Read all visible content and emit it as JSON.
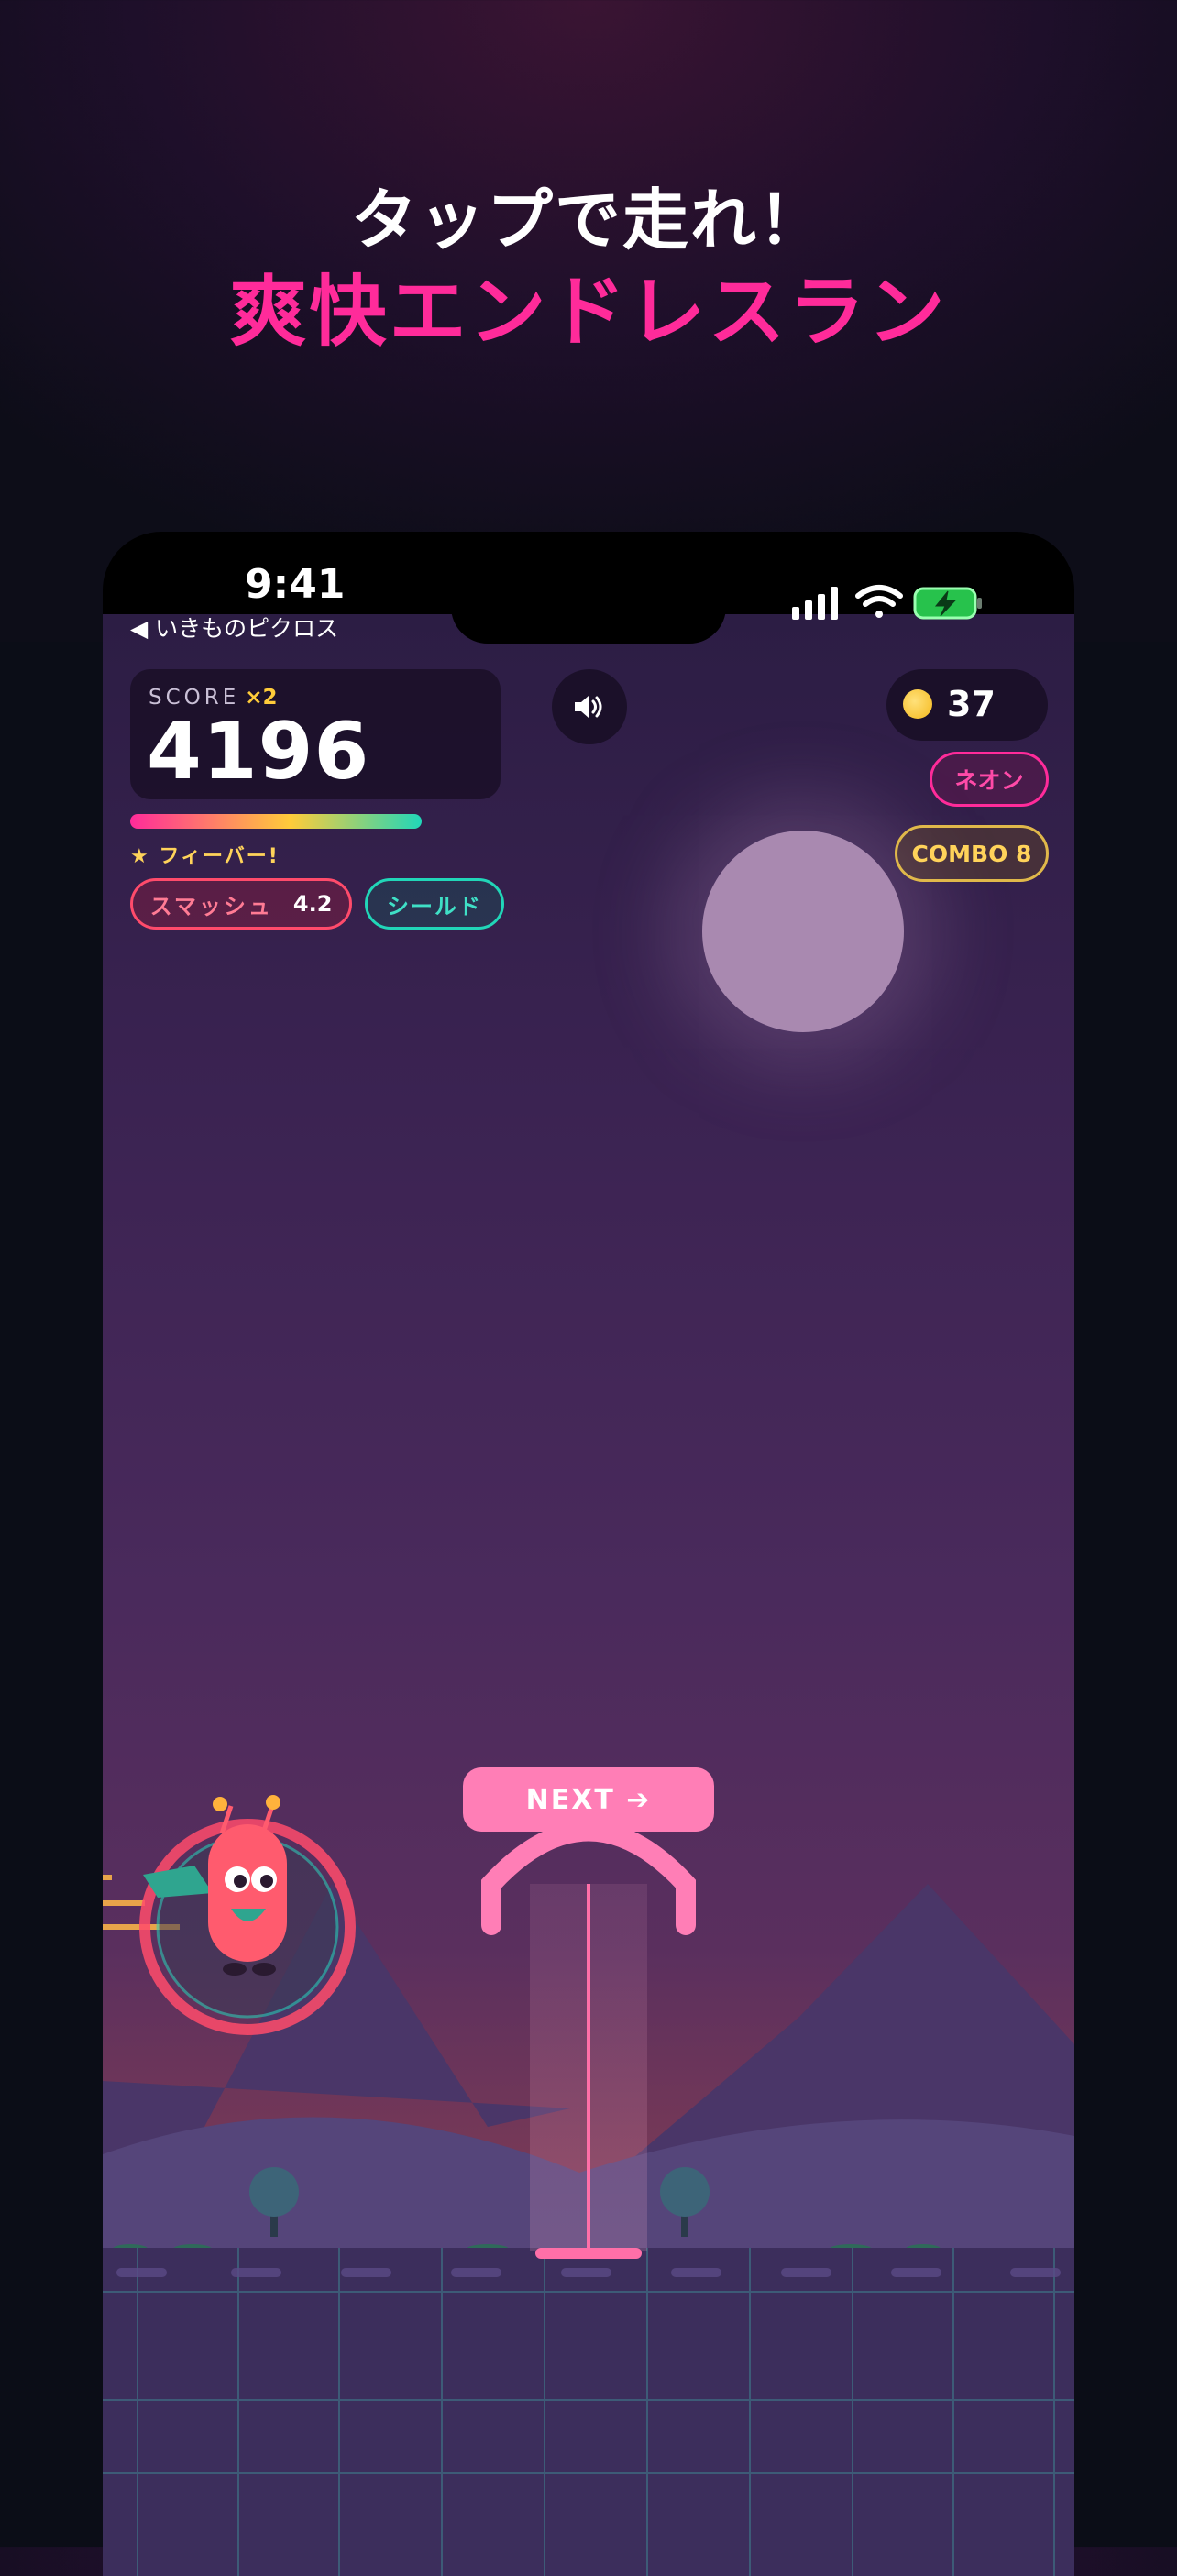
{
  "promo": {
    "line1": "タップで走れ！",
    "line2": "爽快エンドレスラン"
  },
  "status_bar": {
    "time": "9:41",
    "back_label": "◀ いきものピクロス"
  },
  "hud": {
    "score_label": "SCORE",
    "multiplier": "×2",
    "score": "4196",
    "fever_label": "★ フィーバー!",
    "smash_label": "スマッシュ",
    "smash_value": "4.2",
    "shield_label": "シールド",
    "coins": "37",
    "neon_tag": "ネオン",
    "combo_tag": "COMBO 8"
  },
  "game": {
    "next_label": "NEXT ➔"
  },
  "colors": {
    "accent_pink": "#ff2b9a",
    "teal": "#21d6b8",
    "gold": "#ffcc3a"
  },
  "icons": [
    "sound-icon",
    "coin-icon",
    "signal-icon",
    "wifi-icon",
    "battery-icon"
  ]
}
